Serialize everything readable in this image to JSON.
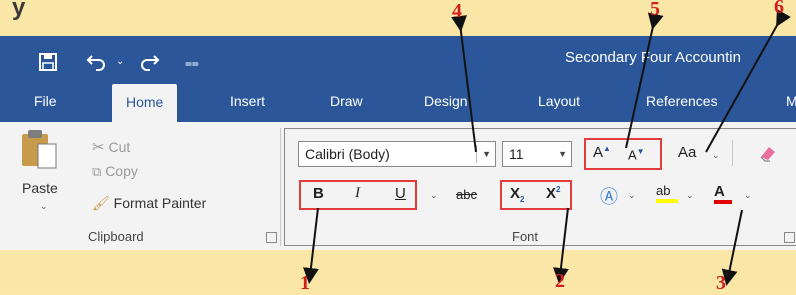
{
  "header_partial": "y",
  "title": "Secondary Four Accountin",
  "tabs": [
    "File",
    "Home",
    "Insert",
    "Draw",
    "Design",
    "Layout",
    "References",
    "M"
  ],
  "clipboard": {
    "paste": "Paste",
    "cut": "Cut",
    "copy": "Copy",
    "format_painter": "Format Painter",
    "group_label": "Clipboard"
  },
  "font": {
    "font_name": "Calibri (Body)",
    "font_size": "11",
    "group_label": "Font",
    "grow": "A",
    "shrink": "A",
    "change_case": "Aa",
    "bold": "B",
    "italic": "I",
    "underline": "U",
    "strikethrough": "abc",
    "subscript": "X",
    "subscript_mark": "2",
    "superscript": "X",
    "superscript_mark": "2",
    "highlight": "ab",
    "font_color": "A"
  },
  "annotations": [
    "4",
    "5",
    "6",
    "1",
    "2",
    "3"
  ],
  "colors": {
    "ribbon_blue": "#2b579a",
    "annotation_red": "#e23b3b",
    "highlight_yellow": "#ffff00",
    "font_color_red": "#e00000"
  }
}
